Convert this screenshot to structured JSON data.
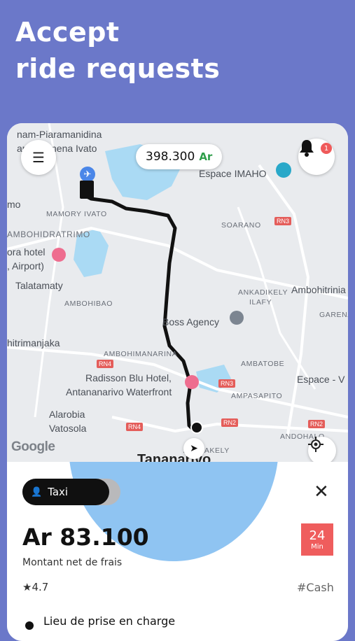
{
  "headline": {
    "line1": "Accept",
    "line2": "ride requests"
  },
  "map": {
    "balance": {
      "amount": "398.300",
      "currency": "Ar"
    },
    "notifications": {
      "count": "1",
      "icon": "bell-icon"
    },
    "menu_icon": "hamburger-menu-icon",
    "locate_icon": "crosshair-icon",
    "nav_icon": "navigation-arrow-icon",
    "attribution": "Google",
    "labels": {
      "l1": "nam-Piaramanidina",
      "l2": "am-Pirenena Ivato",
      "l3": "Espace IMAHO",
      "l4": "mo",
      "l5": "MAMORY IVATO",
      "l6": "SOARANO",
      "l7": "AMBOHIDRATRIMO",
      "l8": "ora hotel",
      "l9": ", Airport)",
      "l10": "Talatamaty",
      "l11": "AMBOHIBAO",
      "l12": "ANKADIKELY",
      "l13": "ILAFY",
      "l14": "Ambohitrinia",
      "l15": "GARENA",
      "l16": "Boss Agency",
      "l17": "hitrimanjaka",
      "l18": "AMBOHIMANARINA",
      "l19": "AMBATOBE",
      "l20": "Radisson Blu Hotel,",
      "l21": "Antananarivo Waterfront",
      "l22": "Espace - V",
      "l23": "AMPASAPITO",
      "l24": "Alarobia",
      "l25": "Vatosola",
      "l26": "ANDOHALO",
      "l27": "ANALAKELY",
      "l28": "Tananarivo"
    },
    "roads": {
      "r1": "RN3",
      "r2": "RN4",
      "r3": "RN3",
      "r4": "RN2",
      "r5": "RN4",
      "r6": "RN2"
    }
  },
  "request": {
    "service": "Taxi",
    "price": "Ar 83.100",
    "price_note": "Montant net de frais",
    "eta_value": "24",
    "eta_unit": "Min",
    "rating": "4.7",
    "payment": "#Cash",
    "pickup_label": "Lieu de prise en charge",
    "colors": {
      "eta_bg": "#ef5d5d",
      "accent_green": "#2e9e4a",
      "backdrop": "#6b78c9"
    }
  }
}
